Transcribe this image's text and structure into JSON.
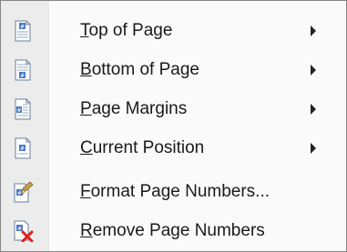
{
  "menu": {
    "items": [
      {
        "accel": "T",
        "rest": "op of Page",
        "icon": "page-top-icon",
        "submenu": true
      },
      {
        "accel": "B",
        "rest": "ottom of Page",
        "icon": "page-bottom-icon",
        "submenu": true
      },
      {
        "accel": "P",
        "rest": "age Margins",
        "icon": "page-margins-icon",
        "submenu": true
      },
      {
        "accel": "C",
        "rest": "urrent Position",
        "icon": "current-position-icon",
        "submenu": true
      },
      {
        "accel": "F",
        "rest": "ormat Page Numbers...",
        "icon": "format-page-numbers-icon",
        "submenu": false
      },
      {
        "accel": "R",
        "rest": "emove Page Numbers",
        "icon": "remove-page-numbers-icon",
        "submenu": false
      }
    ],
    "colors": {
      "gutter": "#ececec",
      "border": "#868686",
      "icon_blue": "#4a79c5",
      "remove_red": "#e0201c"
    }
  }
}
